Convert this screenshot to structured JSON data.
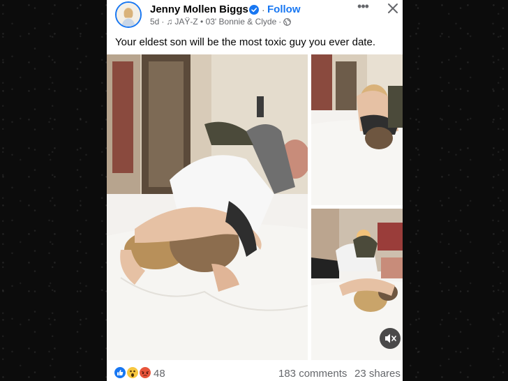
{
  "post": {
    "author": "Jenny Mollen Biggs",
    "follow_label": "Follow",
    "dot_separator": "·",
    "timestamp": "5d",
    "audio": "JAŸ-Z • 03' Bonnie & Clyde",
    "caption": "Your eldest son will be the most toxic guy you ever date.",
    "reaction_count": "48",
    "comments": "183 comments",
    "shares": "23 shares"
  },
  "icons": {
    "verified": "verified-badge-icon",
    "music": "music-note-icon",
    "audience": "globe-icon",
    "more": "more-options-icon",
    "close": "close-icon",
    "mute": "speaker-muted-icon",
    "reactions": [
      "like-icon",
      "wow-icon",
      "angry-icon"
    ]
  },
  "colors": {
    "accent": "#1877f2",
    "text": "#050505",
    "secondary_text": "#65676b",
    "background": "#0c0c0c"
  }
}
